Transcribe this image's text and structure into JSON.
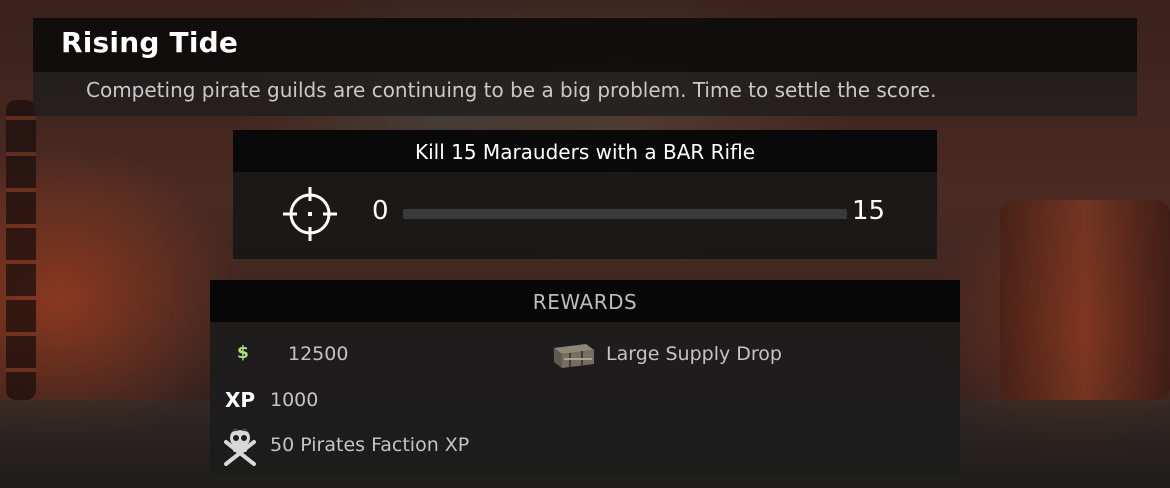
{
  "mission": {
    "title": "Rising Tide",
    "description": "Competing pirate guilds are continuing to be a big problem. Time to settle the score."
  },
  "objective": {
    "text": "Kill 15 Marauders with a BAR Rifle",
    "icon": "crosshair-icon",
    "progress": {
      "current": "0",
      "max": "15",
      "fraction": 0
    }
  },
  "rewards": {
    "header": "REWARDS",
    "items": [
      {
        "icon": "dollar-icon",
        "icon_text": "$",
        "label": "12500"
      },
      {
        "icon": "xp-icon",
        "icon_text": "XP",
        "label": "1000"
      },
      {
        "icon": "pirate-skull-icon",
        "label": "50 Pirates Faction XP"
      },
      {
        "icon": "supply-crate-icon",
        "label": "Large Supply Drop"
      }
    ]
  },
  "colors": {
    "money": "#a7e57a",
    "panel_dark": "#0a0a0a",
    "text_primary": "#ffffff",
    "text_secondary": "#c4c4c4"
  }
}
